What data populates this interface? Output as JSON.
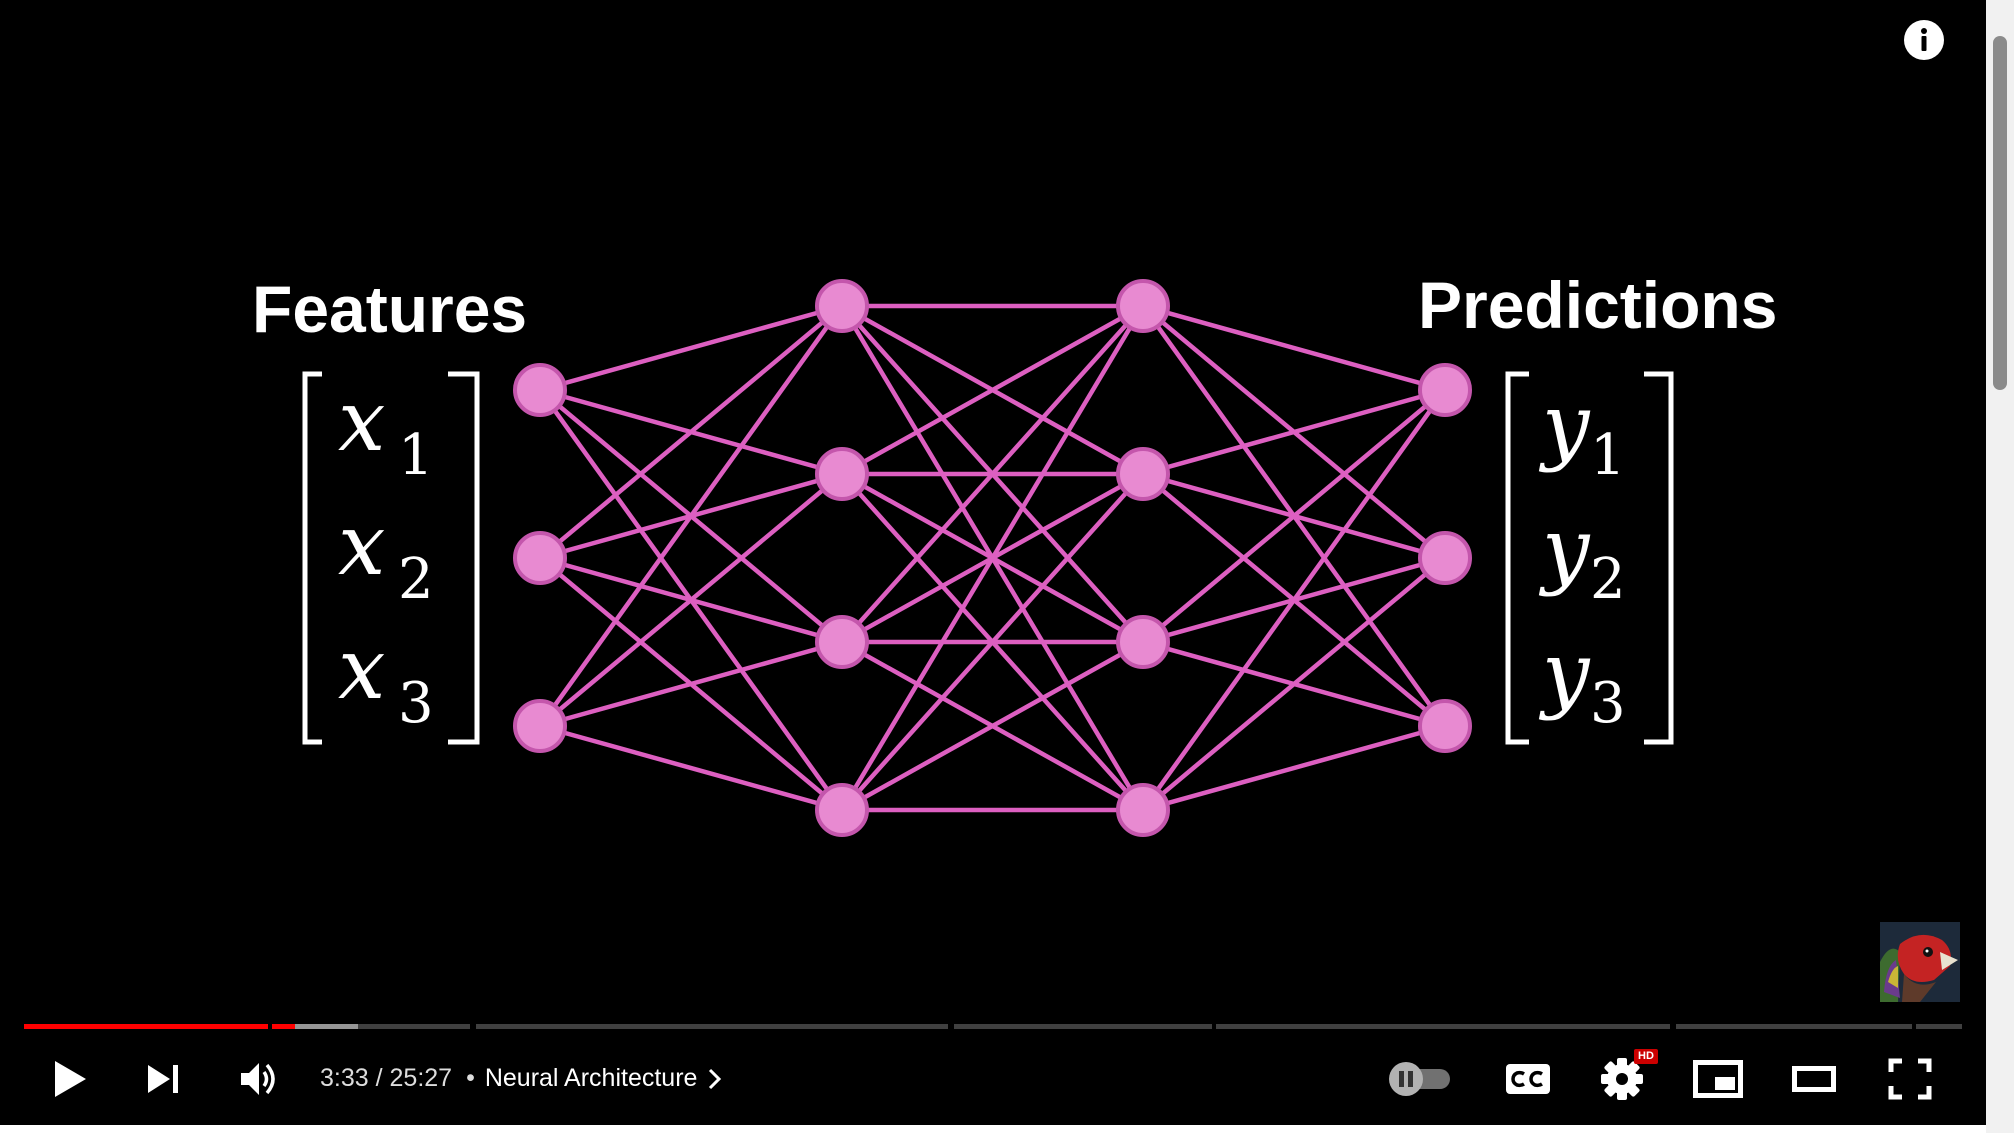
{
  "overlay": {
    "info_icon": "info-icon",
    "watermark": "channel-avatar"
  },
  "video": {
    "features_label": "Features",
    "predictions_label": "Predictions",
    "input_vector": {
      "symbol": "x",
      "subscripts": [
        "1",
        "2",
        "3"
      ]
    },
    "output_vector": {
      "symbol": "y",
      "subscripts": [
        "1",
        "2",
        "3"
      ]
    },
    "network": {
      "layers": [
        3,
        4,
        4,
        3
      ],
      "node_color": "#e88ad1",
      "edge_color": "#dd5fc1"
    }
  },
  "player": {
    "progress": {
      "current_fraction": 0.1396,
      "accent": "#ff0000"
    },
    "time": {
      "current": "3:33",
      "separator": " / ",
      "duration": "25:27"
    },
    "chapter": {
      "dot": "•",
      "title": "Neural Architecture"
    },
    "icons": {
      "play": "play-icon",
      "next": "next-icon",
      "volume": "volume-icon",
      "autoplay": "autoplay-toggle-icon",
      "captions": "captions-icon",
      "settings": "settings-icon",
      "miniplayer": "miniplayer-icon",
      "theater": "theater-mode-icon",
      "fullscreen": "fullscreen-icon"
    },
    "hd_badge": "HD"
  }
}
